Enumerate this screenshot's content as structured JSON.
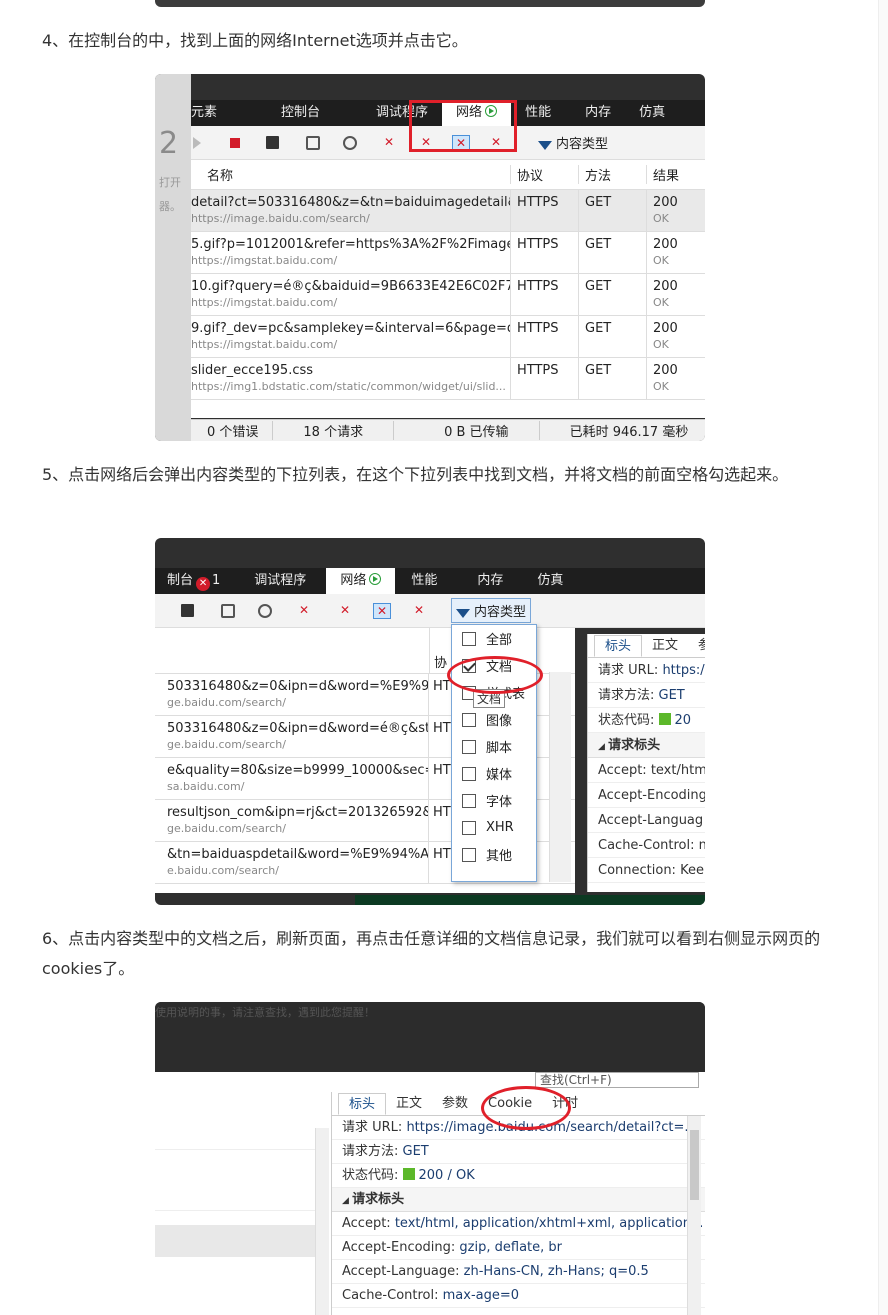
{
  "steps": [
    {
      "text": "4、在控制台的中，找到上面的网络Internet选项并点击它。"
    },
    {
      "text": "5、点击网络后会弹出内容类型的下拉列表，在这个下拉列表中找到文档，并将文档的前面空格勾选起来。"
    },
    {
      "text": "6、点击内容类型中的文档之后，刷新页面，再点击任意详细的文档信息记录，我们就可以看到右侧显示网页的cookies了。"
    }
  ],
  "shot1": {
    "tabs": [
      "元素",
      "控制台",
      "调试程序",
      "网络",
      "性能",
      "内存",
      "仿真"
    ],
    "side_num": "2",
    "side_text1": "打开",
    "side_text2": "器。",
    "filter_label": "内容类型",
    "headers": {
      "name": "名称",
      "protocol": "协议",
      "method": "方法",
      "result": "结果"
    },
    "rows": [
      {
        "name": "detail?ct=503316480&z=&tn=baiduimagedetail&i...",
        "url": "https://image.baidu.com/search/",
        "protocol": "HTTPS",
        "method": "GET",
        "code": "200",
        "status": "OK"
      },
      {
        "name": "5.gif?p=1012001&refer=https%3A%2F%2Fimage.b...",
        "url": "https://imgstat.baidu.com/",
        "protocol": "HTTPS",
        "method": "GET",
        "code": "200",
        "status": "OK"
      },
      {
        "name": "10.gif?query=é®ç&baiduid=9B6633E42E6C02F7A8...",
        "url": "https://imgstat.baidu.com/",
        "protocol": "HTTPS",
        "method": "GET",
        "code": "200",
        "status": "OK"
      },
      {
        "name": "9.gif?_dev=pc&samplekey=&interval=6&page=det...",
        "url": "https://imgstat.baidu.com/",
        "protocol": "HTTPS",
        "method": "GET",
        "code": "200",
        "status": "OK"
      },
      {
        "name": "slider_ecce195.css",
        "url": "https://img1.bdstatic.com/static/common/widget/ui/slid...",
        "protocol": "HTTPS",
        "method": "GET",
        "code": "200",
        "status": "OK"
      }
    ],
    "status_bar": [
      "0 个错误",
      "18 个请求",
      "0 B 已传输",
      "已耗时 946.17 毫秒"
    ]
  },
  "shot2": {
    "tabs": [
      "制台",
      "调试程序",
      "网络",
      "性能",
      "内存",
      "仿真"
    ],
    "error_count": "1",
    "filter_label": "内容类型",
    "col_partial": "协",
    "rows": [
      {
        "name": "503316480&z=0&ipn=d&word=%E9%94...",
        "url": "ge.baidu.com/search/",
        "protocol": "HT"
      },
      {
        "name": "503316480&z=0&ipn=d&word=é®ç&st...",
        "url": "ge.baidu.com/search/",
        "protocol": "HT"
      },
      {
        "name": "e&quality=80&size=b9999_10000&sec=...",
        "url": "sa.baidu.com/",
        "protocol": "HT"
      },
      {
        "name": "resultjson_com&ipn=rj&ct=201326592&...",
        "url": "ge.baidu.com/search/",
        "protocol": "HT"
      },
      {
        "name": "&tn=baiduaspdetail&word=%E9%94%AE...",
        "url": "e.baidu.com/search/",
        "protocol": "HT"
      }
    ],
    "dropdown": [
      {
        "label": "全部",
        "checked": false
      },
      {
        "label": "文档",
        "checked": true
      },
      {
        "label": "样式表",
        "checked": false
      },
      {
        "label": "图像",
        "checked": false
      },
      {
        "label": "脚本",
        "checked": false
      },
      {
        "label": "媒体",
        "checked": false
      },
      {
        "label": "字体",
        "checked": false
      },
      {
        "label": "XHR",
        "checked": false
      },
      {
        "label": "其他",
        "checked": false
      }
    ],
    "tooltip": "文档",
    "panel_tabs": [
      "标头",
      "正文",
      "参"
    ],
    "panel_rows": {
      "url_label": "请求 URL: ",
      "url_val": "https:/",
      "method_label": "请求方法: ",
      "method_val": "GET",
      "code_label": "状态代码: ",
      "code_val": "20"
    },
    "section": "请求标头",
    "headers": [
      "Accept: text/htm",
      "Accept-Encoding",
      "Accept-Languag",
      "Cache-Control: n",
      "Connection: Keep"
    ]
  },
  "shot3": {
    "faded_text": "使用说明的事，请注意查找，遇到此您提醒！",
    "search_placeholder": "查找(Ctrl+F)",
    "panel_tabs": [
      "标头",
      "正文",
      "参数",
      "Cookie",
      "计时"
    ],
    "url_label": "请求 URL: ",
    "url_val": "https://image.baidu.com/search/detail?ct=...",
    "method_label": "请求方法: ",
    "method_val": "GET",
    "code_label": "状态代码: ",
    "code_val": "200 / OK",
    "section": "请求标头",
    "headers": [
      {
        "k": "Accept: ",
        "v": "text/html, application/xhtml+xml, application..."
      },
      {
        "k": "Accept-Encoding: ",
        "v": "gzip, deflate, br"
      },
      {
        "k": "Accept-Language: ",
        "v": "zh-Hans-CN, zh-Hans; q=0.5"
      },
      {
        "k": "Cache-Control: ",
        "v": "max-age=0"
      }
    ]
  }
}
